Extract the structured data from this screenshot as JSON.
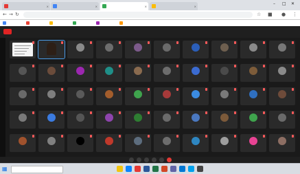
{
  "browser": {
    "tabs": [
      {
        "label": "",
        "color": "#e53935",
        "active": false
      },
      {
        "label": "",
        "color": "#4285f4",
        "active": false
      },
      {
        "label": "",
        "color": "#34a853",
        "active": true
      },
      {
        "label": "",
        "color": "#fbbc05",
        "active": false
      }
    ],
    "url": "",
    "bookmarks": [
      {
        "label": "",
        "color": "#4285f4"
      },
      {
        "label": "",
        "color": "#ea4335"
      },
      {
        "label": "",
        "color": "#fbbc05"
      },
      {
        "label": "",
        "color": "#34a853"
      },
      {
        "label": "",
        "color": "#9c27b0"
      },
      {
        "label": "",
        "color": "#ff9800"
      }
    ]
  },
  "meeting": {
    "record_label": "",
    "title": "",
    "status": "",
    "participants": [
      {
        "name": "",
        "color": "#f0f0f0",
        "type": "shared"
      },
      {
        "name": "",
        "color": "#2d1f16",
        "type": "video"
      },
      {
        "name": "",
        "color": "#8a8a8a"
      },
      {
        "name": "",
        "color": "#6d6d6d"
      },
      {
        "name": "",
        "color": "#7c5a8a"
      },
      {
        "name": "",
        "color": "#6a6a6a"
      },
      {
        "name": "",
        "color": "#2b5eb8"
      },
      {
        "name": "",
        "color": "#6e5f4f"
      },
      {
        "name": "",
        "color": "#8a8a8a"
      },
      {
        "name": "",
        "color": "#777777"
      },
      {
        "name": "",
        "color": "#555555"
      },
      {
        "name": "",
        "color": "#6b4c3b"
      },
      {
        "name": "",
        "color": "#9c27b0"
      },
      {
        "name": "",
        "color": "#1f8f88"
      },
      {
        "name": "",
        "color": "#8a6b4f"
      },
      {
        "name": "",
        "color": "#6d6d6d"
      },
      {
        "name": "",
        "color": "#3b6bd1"
      },
      {
        "name": "",
        "color": "#4a4a4a"
      },
      {
        "name": "",
        "color": "#7d5c3a"
      },
      {
        "name": "",
        "color": "#8a8a8a"
      },
      {
        "name": "",
        "color": "#6a6a6a"
      },
      {
        "name": "",
        "color": "#7f7f7f"
      },
      {
        "name": "",
        "color": "#5a5a5a"
      },
      {
        "name": "",
        "color": "#a35d2c"
      },
      {
        "name": "",
        "color": "#3fa34d"
      },
      {
        "name": "",
        "color": "#a63a3a"
      },
      {
        "name": "",
        "color": "#3b8be0"
      },
      {
        "name": "",
        "color": "#7a7a7a"
      },
      {
        "name": "",
        "color": "#2f6fbf"
      },
      {
        "name": "",
        "color": "#6e4b3a"
      },
      {
        "name": "",
        "color": "#7a7a7a"
      },
      {
        "name": "",
        "color": "#3b7be0"
      },
      {
        "name": "",
        "color": "#555555"
      },
      {
        "name": "",
        "color": "#8e44ad"
      },
      {
        "name": "",
        "color": "#2e7d32"
      },
      {
        "name": "",
        "color": "#6a6a6a"
      },
      {
        "name": "",
        "color": "#4a78c0"
      },
      {
        "name": "",
        "color": "#7c5a3a"
      },
      {
        "name": "",
        "color": "#3fa34d"
      },
      {
        "name": "",
        "color": "#6a6a6a"
      },
      {
        "name": "",
        "color": "#a0522d"
      },
      {
        "name": "",
        "color": "#808080"
      },
      {
        "name": "",
        "color": "#000000"
      },
      {
        "name": "",
        "color": "#c0392b"
      },
      {
        "name": "",
        "color": "#5d6d7e"
      },
      {
        "name": "",
        "color": "#6d6d6d"
      },
      {
        "name": "",
        "color": "#2e86c1"
      },
      {
        "name": "",
        "color": "#9e9e9e"
      },
      {
        "name": "",
        "color": "#e84393"
      },
      {
        "name": "",
        "color": "#8d6e63"
      }
    ],
    "controls": [
      {
        "icon": "mic-icon",
        "color": "#3c3c3c"
      },
      {
        "icon": "camera-icon",
        "color": "#3c3c3c"
      },
      {
        "icon": "present-icon",
        "color": "#3c3c3c"
      },
      {
        "icon": "raise-hand-icon",
        "color": "#3c3c3c"
      },
      {
        "icon": "more-icon",
        "color": "#3c3c3c"
      },
      {
        "icon": "leave-call-icon",
        "color": "#e53935"
      }
    ]
  },
  "taskbar": {
    "search_placeholder": "",
    "apps": [
      {
        "icon": "file-explorer-icon",
        "color": "#f1c40f"
      },
      {
        "icon": "edge-icon",
        "color": "#0a84ff"
      },
      {
        "icon": "chrome-icon",
        "color": "#e53935"
      },
      {
        "icon": "word-icon",
        "color": "#2b579a"
      },
      {
        "icon": "excel-icon",
        "color": "#217346"
      },
      {
        "icon": "powerpoint-icon",
        "color": "#d24726"
      },
      {
        "icon": "teams-icon",
        "color": "#6264a7"
      },
      {
        "icon": "mail-icon",
        "color": "#0078d4"
      },
      {
        "icon": "photos-icon",
        "color": "#00a2ed"
      },
      {
        "icon": "store-icon",
        "color": "#444444"
      }
    ],
    "time": "",
    "date": ""
  }
}
